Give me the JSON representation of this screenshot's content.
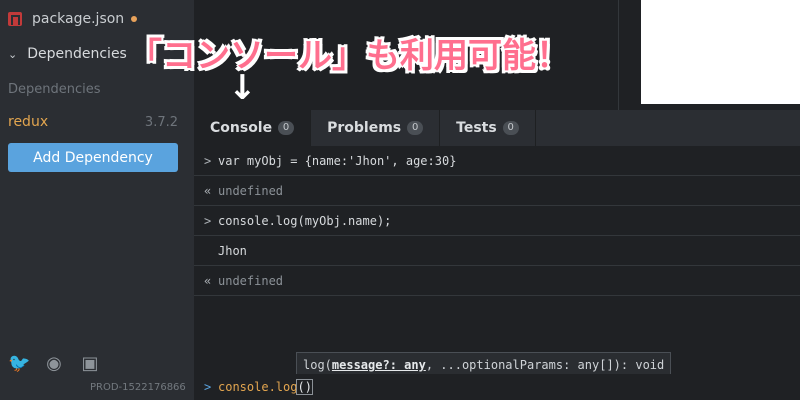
{
  "sidebar": {
    "file_name": "package.json",
    "section_label": "Dependencies",
    "subheading": "Dependencies",
    "dependency": {
      "name": "redux",
      "version": "3.7.2"
    },
    "add_button_label": "Add Dependency",
    "social_icons": [
      "twitter-icon",
      "github-icon",
      "discord-icon"
    ],
    "build_id": "PROD-1522176866"
  },
  "annotation": {
    "headline": "「コンソール」も利用可能！",
    "arrow": "↓"
  },
  "tabs": [
    {
      "label": "Console",
      "count": "0",
      "active": true
    },
    {
      "label": "Problems",
      "count": "0",
      "active": false
    },
    {
      "label": "Tests",
      "count": "0",
      "active": false
    }
  ],
  "console": {
    "lines": [
      {
        "kind": "input",
        "prompt": ">",
        "text": "var myObj = {name:'Jhon', age:30}"
      },
      {
        "kind": "result",
        "prompt": "«",
        "text": "undefined"
      },
      {
        "kind": "input",
        "prompt": ">",
        "text": "console.log(myObj.name);"
      },
      {
        "kind": "output",
        "prompt": "",
        "text": "Jhon"
      },
      {
        "kind": "result",
        "prompt": "«",
        "text": "undefined"
      }
    ],
    "tooltip": {
      "prefix": "log(",
      "param": "message?: any",
      "suffix": ", ...optionalParams: any[]): void"
    },
    "input": {
      "prompt": ">",
      "text": "console.log",
      "paren": "()"
    }
  },
  "colors": {
    "accent": "#5aa3de",
    "dependency_name": "#e2a54f",
    "headline": "#ff6f8e"
  }
}
